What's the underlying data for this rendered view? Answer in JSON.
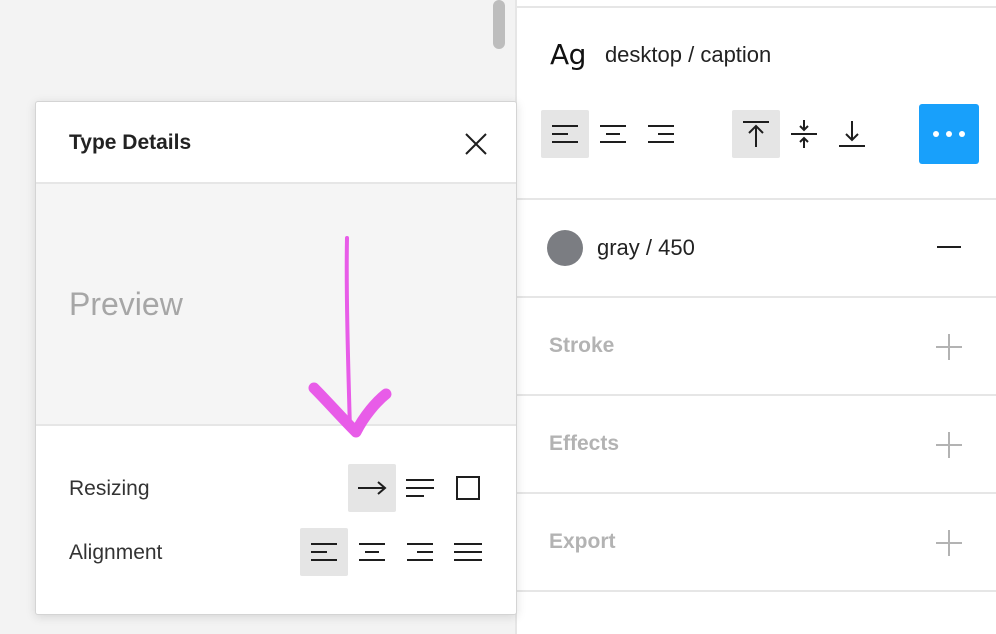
{
  "right_panel": {
    "text_style": {
      "glyph": "Ag",
      "name": "desktop / caption"
    },
    "text_align_options": [
      "align-left",
      "align-center",
      "align-right"
    ],
    "vertical_align_options": [
      "align-top",
      "align-middle",
      "align-bottom"
    ],
    "active_text_align": "align-left",
    "active_vertical_align": "align-top",
    "fill": {
      "name": "gray / 450",
      "color": "#7b7d82"
    },
    "sections": [
      {
        "label": "Stroke"
      },
      {
        "label": "Effects"
      },
      {
        "label": "Export"
      }
    ],
    "accent_color": "#18a0fb"
  },
  "modal": {
    "title": "Type Details",
    "preview_text": "Preview",
    "resizing_label": "Resizing",
    "alignment_label": "Alignment",
    "resizing_options": [
      "auto-width",
      "auto-height",
      "fixed-size"
    ],
    "active_resizing": "auto-width",
    "alignment_options": [
      "align-left",
      "align-center",
      "align-right",
      "justify"
    ],
    "active_alignment": "align-left"
  },
  "annotation": {
    "color": "#e85ce8"
  }
}
